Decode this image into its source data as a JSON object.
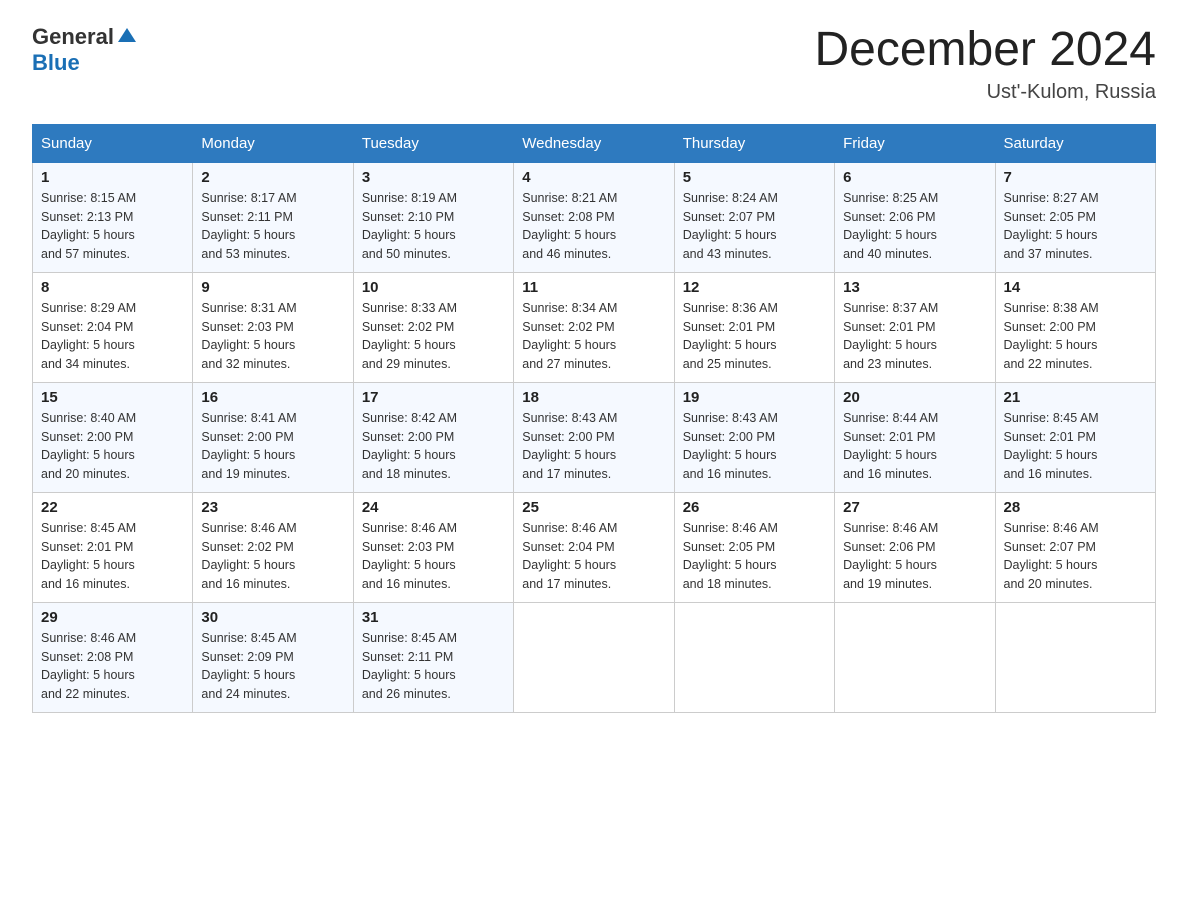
{
  "logo": {
    "general": "General",
    "triangle_indicator": "▶",
    "blue": "Blue"
  },
  "title": {
    "month_year": "December 2024",
    "location": "Ust'-Kulom, Russia"
  },
  "weekdays": [
    "Sunday",
    "Monday",
    "Tuesday",
    "Wednesday",
    "Thursday",
    "Friday",
    "Saturday"
  ],
  "weeks": [
    [
      {
        "day": "1",
        "sunrise": "8:15 AM",
        "sunset": "2:13 PM",
        "daylight": "5 hours and 57 minutes."
      },
      {
        "day": "2",
        "sunrise": "8:17 AM",
        "sunset": "2:11 PM",
        "daylight": "5 hours and 53 minutes."
      },
      {
        "day": "3",
        "sunrise": "8:19 AM",
        "sunset": "2:10 PM",
        "daylight": "5 hours and 50 minutes."
      },
      {
        "day": "4",
        "sunrise": "8:21 AM",
        "sunset": "2:08 PM",
        "daylight": "5 hours and 46 minutes."
      },
      {
        "day": "5",
        "sunrise": "8:24 AM",
        "sunset": "2:07 PM",
        "daylight": "5 hours and 43 minutes."
      },
      {
        "day": "6",
        "sunrise": "8:25 AM",
        "sunset": "2:06 PM",
        "daylight": "5 hours and 40 minutes."
      },
      {
        "day": "7",
        "sunrise": "8:27 AM",
        "sunset": "2:05 PM",
        "daylight": "5 hours and 37 minutes."
      }
    ],
    [
      {
        "day": "8",
        "sunrise": "8:29 AM",
        "sunset": "2:04 PM",
        "daylight": "5 hours and 34 minutes."
      },
      {
        "day": "9",
        "sunrise": "8:31 AM",
        "sunset": "2:03 PM",
        "daylight": "5 hours and 32 minutes."
      },
      {
        "day": "10",
        "sunrise": "8:33 AM",
        "sunset": "2:02 PM",
        "daylight": "5 hours and 29 minutes."
      },
      {
        "day": "11",
        "sunrise": "8:34 AM",
        "sunset": "2:02 PM",
        "daylight": "5 hours and 27 minutes."
      },
      {
        "day": "12",
        "sunrise": "8:36 AM",
        "sunset": "2:01 PM",
        "daylight": "5 hours and 25 minutes."
      },
      {
        "day": "13",
        "sunrise": "8:37 AM",
        "sunset": "2:01 PM",
        "daylight": "5 hours and 23 minutes."
      },
      {
        "day": "14",
        "sunrise": "8:38 AM",
        "sunset": "2:00 PM",
        "daylight": "5 hours and 22 minutes."
      }
    ],
    [
      {
        "day": "15",
        "sunrise": "8:40 AM",
        "sunset": "2:00 PM",
        "daylight": "5 hours and 20 minutes."
      },
      {
        "day": "16",
        "sunrise": "8:41 AM",
        "sunset": "2:00 PM",
        "daylight": "5 hours and 19 minutes."
      },
      {
        "day": "17",
        "sunrise": "8:42 AM",
        "sunset": "2:00 PM",
        "daylight": "5 hours and 18 minutes."
      },
      {
        "day": "18",
        "sunrise": "8:43 AM",
        "sunset": "2:00 PM",
        "daylight": "5 hours and 17 minutes."
      },
      {
        "day": "19",
        "sunrise": "8:43 AM",
        "sunset": "2:00 PM",
        "daylight": "5 hours and 16 minutes."
      },
      {
        "day": "20",
        "sunrise": "8:44 AM",
        "sunset": "2:01 PM",
        "daylight": "5 hours and 16 minutes."
      },
      {
        "day": "21",
        "sunrise": "8:45 AM",
        "sunset": "2:01 PM",
        "daylight": "5 hours and 16 minutes."
      }
    ],
    [
      {
        "day": "22",
        "sunrise": "8:45 AM",
        "sunset": "2:01 PM",
        "daylight": "5 hours and 16 minutes."
      },
      {
        "day": "23",
        "sunrise": "8:46 AM",
        "sunset": "2:02 PM",
        "daylight": "5 hours and 16 minutes."
      },
      {
        "day": "24",
        "sunrise": "8:46 AM",
        "sunset": "2:03 PM",
        "daylight": "5 hours and 16 minutes."
      },
      {
        "day": "25",
        "sunrise": "8:46 AM",
        "sunset": "2:04 PM",
        "daylight": "5 hours and 17 minutes."
      },
      {
        "day": "26",
        "sunrise": "8:46 AM",
        "sunset": "2:05 PM",
        "daylight": "5 hours and 18 minutes."
      },
      {
        "day": "27",
        "sunrise": "8:46 AM",
        "sunset": "2:06 PM",
        "daylight": "5 hours and 19 minutes."
      },
      {
        "day": "28",
        "sunrise": "8:46 AM",
        "sunset": "2:07 PM",
        "daylight": "5 hours and 20 minutes."
      }
    ],
    [
      {
        "day": "29",
        "sunrise": "8:46 AM",
        "sunset": "2:08 PM",
        "daylight": "5 hours and 22 minutes."
      },
      {
        "day": "30",
        "sunrise": "8:45 AM",
        "sunset": "2:09 PM",
        "daylight": "5 hours and 24 minutes."
      },
      {
        "day": "31",
        "sunrise": "8:45 AM",
        "sunset": "2:11 PM",
        "daylight": "5 hours and 26 minutes."
      },
      null,
      null,
      null,
      null
    ]
  ],
  "labels": {
    "sunrise": "Sunrise:",
    "sunset": "Sunset:",
    "daylight": "Daylight:"
  }
}
